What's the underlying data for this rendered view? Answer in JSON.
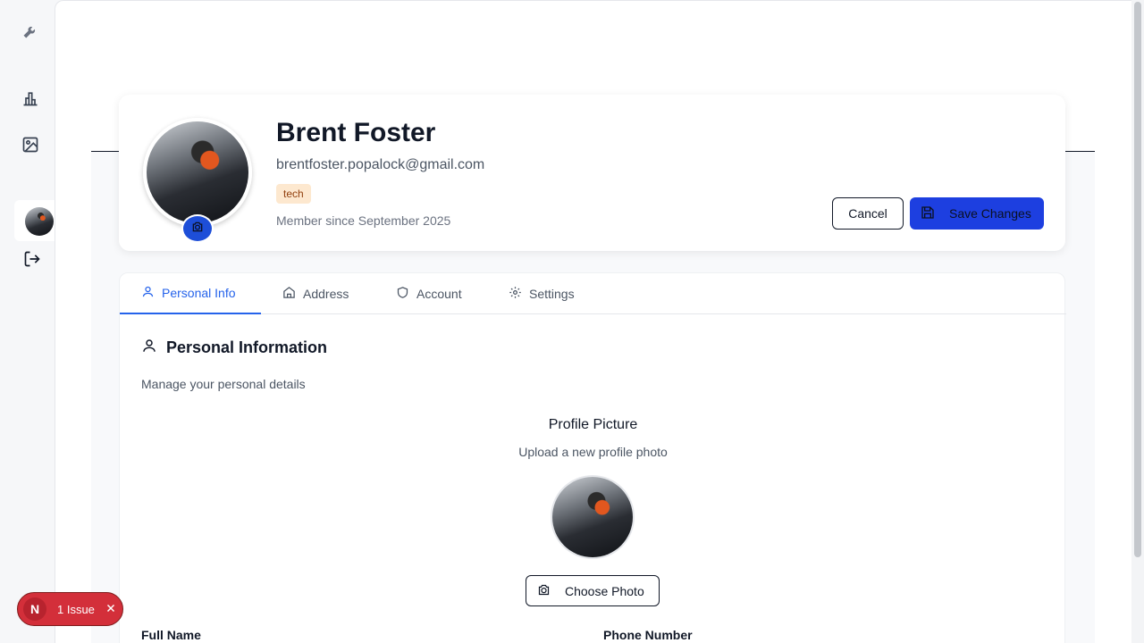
{
  "sidebar": {
    "icons": [
      "wrench-icon",
      "bar-chart-icon",
      "image-icon",
      "user-avatar",
      "logout-icon"
    ]
  },
  "profile": {
    "name": "Brent Foster",
    "email": "brentfoster.popalock@gmail.com",
    "role": "tech",
    "member_since": "Member since September 2025"
  },
  "actions": {
    "cancel_label": "Cancel",
    "save_label": "Save Changes"
  },
  "tabs": [
    {
      "label": "Personal Info",
      "icon": "user-icon",
      "active": true
    },
    {
      "label": "Address",
      "icon": "home-icon",
      "active": false
    },
    {
      "label": "Account",
      "icon": "shield-icon",
      "active": false
    },
    {
      "label": "Settings",
      "icon": "gear-icon",
      "active": false
    }
  ],
  "section": {
    "title": "Personal Information",
    "subtitle": "Manage your personal details",
    "picture_title": "Profile Picture",
    "picture_subtitle": "Upload a new profile photo",
    "choose_photo_label": "Choose Photo",
    "full_name_label": "Full Name",
    "phone_label": "Phone Number"
  },
  "issues_toast": {
    "logo": "N",
    "label": "1 Issue"
  },
  "colors": {
    "accent": "#2563eb",
    "save_button": "#1d3fe0",
    "badge_bg": "#fde8cf",
    "toast": "#d32f3a"
  }
}
